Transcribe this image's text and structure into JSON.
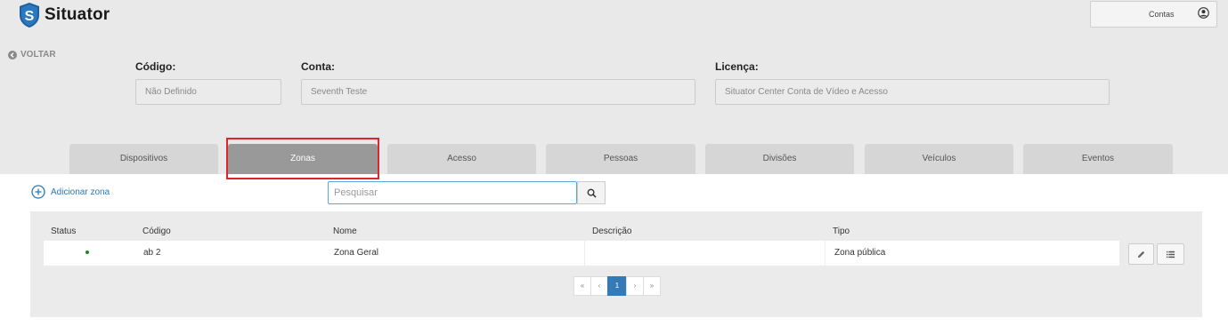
{
  "app": {
    "name": "Situator"
  },
  "topbar": {
    "account_button_label": "Contas",
    "account_icon": "user-circle-icon",
    "logo_icon": "shield-s-logo"
  },
  "header": {
    "back_label": "VOLTAR",
    "fields": {
      "codigo": {
        "label": "Código:",
        "value": "Não Definido"
      },
      "conta": {
        "label": "Conta:",
        "value": "Seventh Teste"
      },
      "licenca": {
        "label": "Licença:",
        "value": "Situator Center Conta de Vídeo e Acesso"
      }
    }
  },
  "tabs": [
    {
      "label": "Dispositivos",
      "active": false
    },
    {
      "label": "Zonas",
      "active": true
    },
    {
      "label": "Acesso",
      "active": false
    },
    {
      "label": "Pessoas",
      "active": false
    },
    {
      "label": "Divisões",
      "active": false
    },
    {
      "label": "Veículos",
      "active": false
    },
    {
      "label": "Eventos",
      "active": false
    }
  ],
  "toolbar": {
    "add_zone_label": "Adicionar zona",
    "search_placeholder": "Pesquisar",
    "search_value": ""
  },
  "table": {
    "columns": [
      "Status",
      "Código",
      "Nome",
      "Descrição",
      "Tipo"
    ],
    "rows": [
      {
        "status": "active",
        "codigo": "ab 2",
        "nome": "Zona Geral",
        "descricao": "",
        "tipo": "Zona pública"
      }
    ],
    "row_actions": [
      "edit-icon",
      "list-icon"
    ]
  },
  "pagination": {
    "first": "«",
    "prev": "‹",
    "current": "1",
    "next": "›",
    "last": "»"
  },
  "colors": {
    "accent": "#337ab7",
    "active_tab": "#999999",
    "highlight": "#e0262a",
    "status_active": "#1e8a1e"
  }
}
